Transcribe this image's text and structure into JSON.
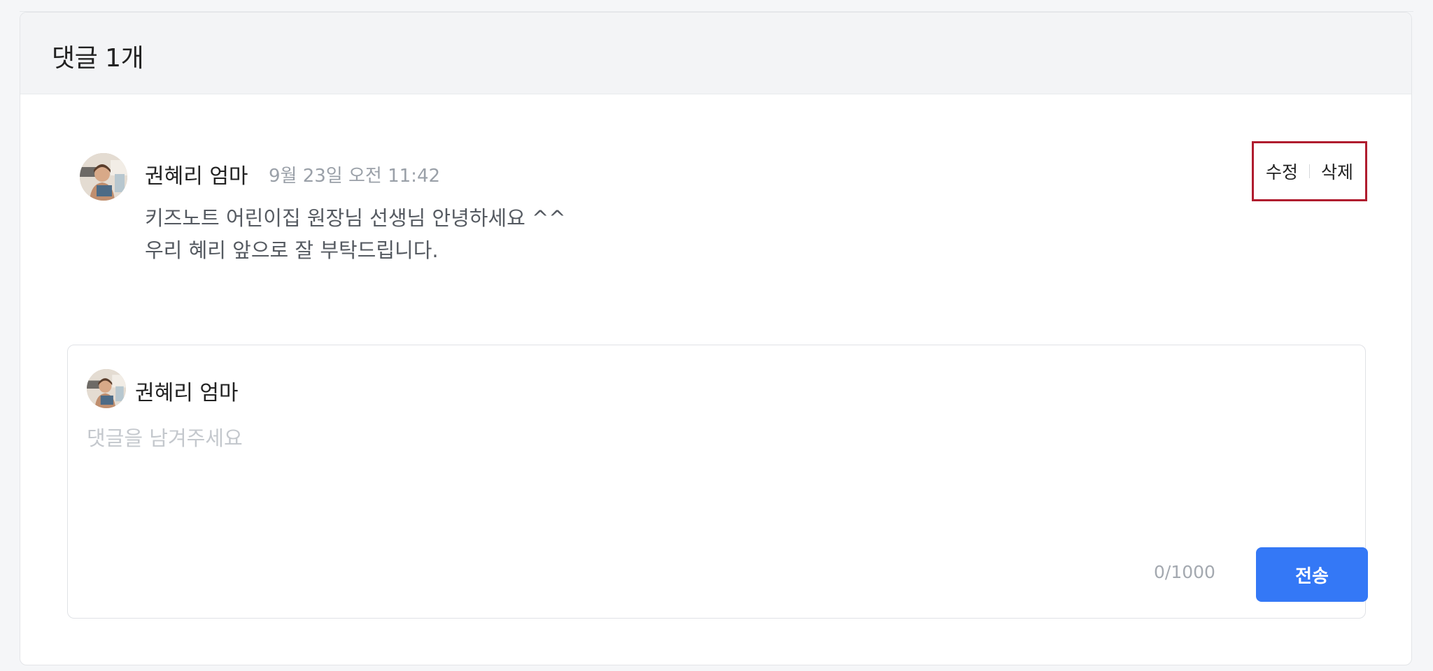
{
  "header": {
    "title": "댓글 1개"
  },
  "comment": {
    "author": "권혜리 엄마",
    "timestamp": "9월 23일 오전 11:42",
    "body_line1": "키즈노트 어린이집 원장님 선생님 안녕하세요 ^^",
    "body_line2": "우리 혜리 앞으로 잘 부탁드립니다.",
    "edit_label": "수정",
    "delete_label": "삭제",
    "avatar_icon": "user-photo-avatar"
  },
  "composer": {
    "author": "권혜리 엄마",
    "placeholder": "댓글을 남겨주세요",
    "value": "",
    "char_count": "0/1000",
    "send_label": "전송",
    "avatar_icon": "user-photo-avatar"
  },
  "colors": {
    "accent": "#3478f6",
    "highlight_border": "#b01c2e",
    "header_bg": "#f3f4f6"
  }
}
